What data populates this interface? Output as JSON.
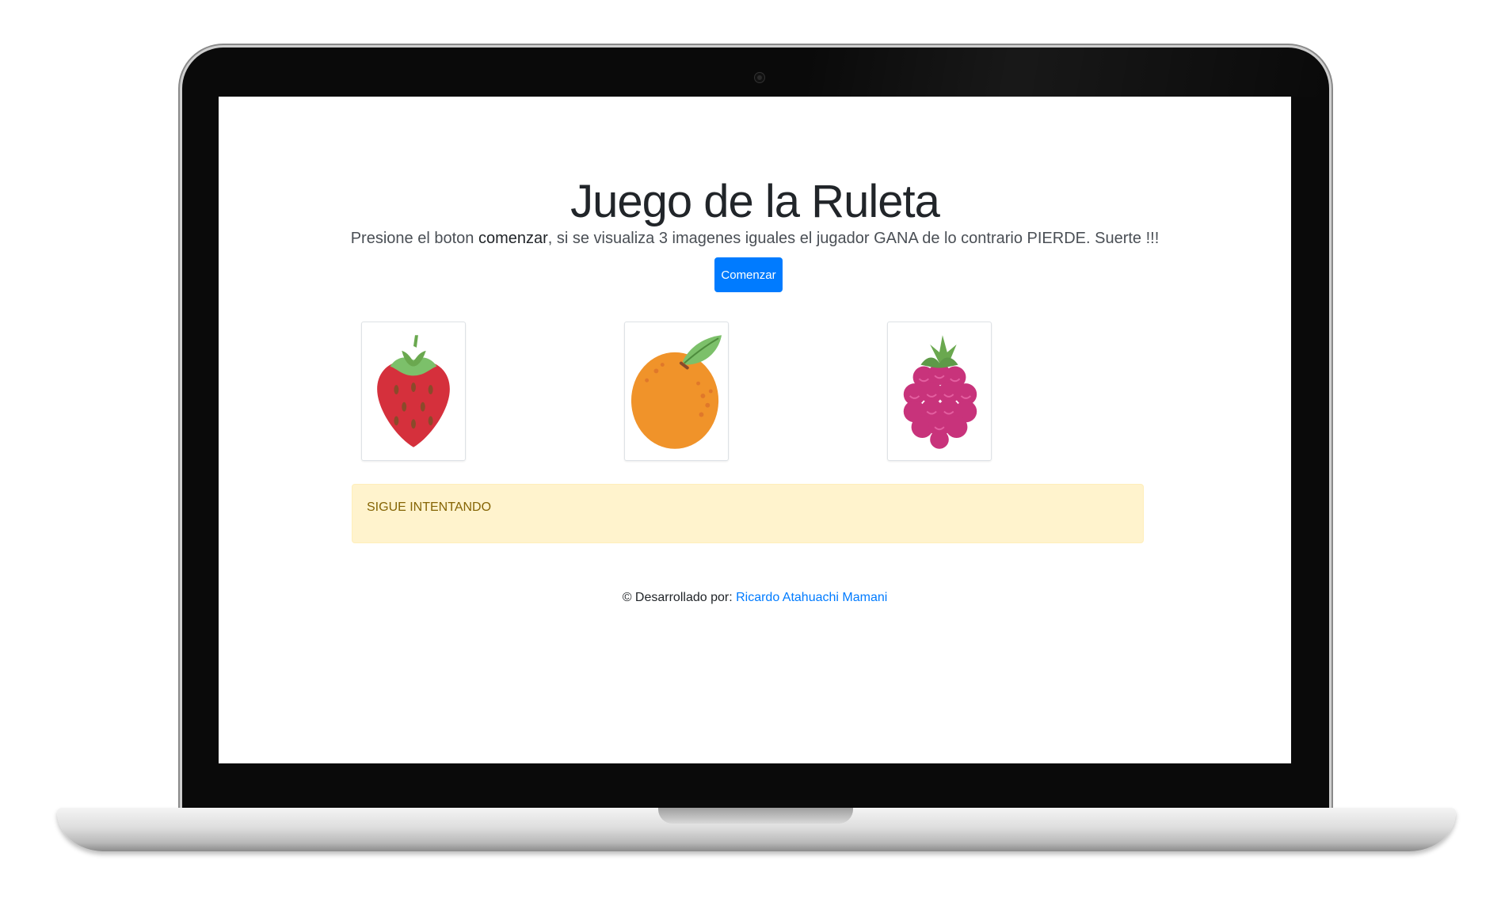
{
  "page": {
    "title": "Juego de la Ruleta",
    "instructions": {
      "before": "Presione el boton ",
      "emphasis": "comenzar",
      "after": ", si se visualiza 3 imagenes iguales el jugador GANA de lo contrario PIERDE. Suerte !!!"
    },
    "start_button_label": "Comenzar"
  },
  "reels": [
    {
      "fruit": "strawberry",
      "icon": "strawberry-icon"
    },
    {
      "fruit": "orange",
      "icon": "orange-icon"
    },
    {
      "fruit": "raspberry",
      "icon": "raspberry-icon"
    }
  ],
  "result": {
    "message": "SIGUE INTENTANDO",
    "status": "warning"
  },
  "footer": {
    "text": "© Desarrollado por: ",
    "author_link": "Ricardo Atahuachi Mamani"
  },
  "colors": {
    "primary": "#007bff",
    "alert_bg": "#fff3cd",
    "alert_text": "#856404"
  }
}
